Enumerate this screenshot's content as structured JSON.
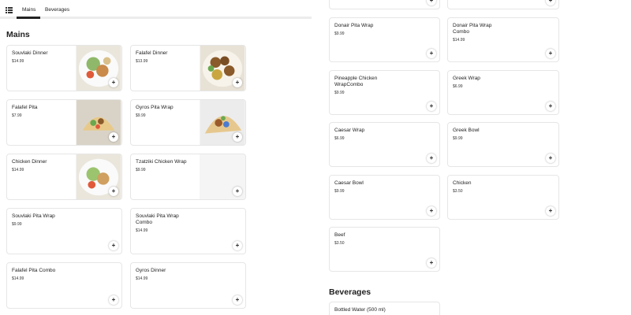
{
  "nav": {
    "tabs": [
      {
        "label": "Mains"
      },
      {
        "label": "Beverages"
      }
    ]
  },
  "sections": {
    "mains_title": "Mains",
    "beverages_title": "Beverages"
  },
  "left_items": [
    {
      "name": "Souvlaki Dinner",
      "price": "$14.99"
    },
    {
      "name": "Falafel Dinner",
      "price": "$13.99"
    },
    {
      "name": "Falafel Pita",
      "price": "$7.99"
    },
    {
      "name": "Gyros Pita Wrap",
      "price": "$9.99"
    },
    {
      "name": "Chicken Dinner",
      "price": "$14.99"
    },
    {
      "name": "Tzatziki Chicken Wrap",
      "price": "$9.99"
    },
    {
      "name": "Souvlaki Pita Wrap",
      "price": "$9.99"
    },
    {
      "name": "Souvlaki Pita Wrap Combo",
      "price": "$14.99"
    },
    {
      "name": "Falafel Pita Combo",
      "price": "$14.99"
    },
    {
      "name": "Gyros Dinner",
      "price": "$14.99"
    }
  ],
  "right_items": [
    {
      "name": "Donair Pita Wrap",
      "price": "$9.99"
    },
    {
      "name": "Donair Pita Wrap Combo",
      "price": "$14.99"
    },
    {
      "name": "Pineapple Chicken WrapCombo",
      "price": "$9.99"
    },
    {
      "name": "Greek Wrap",
      "price": "$6.99"
    },
    {
      "name": "Caesar Wrap",
      "price": "$6.99"
    },
    {
      "name": "Greek Bowl",
      "price": "$9.99"
    },
    {
      "name": "Caesar Bowl",
      "price": "$9.99"
    },
    {
      "name": "Chicken",
      "price": "$3.50"
    },
    {
      "name": "Beef",
      "price": "$3.50"
    }
  ],
  "beverage_items": [
    {
      "name": "Bottled Water (500 ml)",
      "price": ""
    }
  ],
  "icons": {
    "add": "+",
    "menu": "list-icon"
  }
}
